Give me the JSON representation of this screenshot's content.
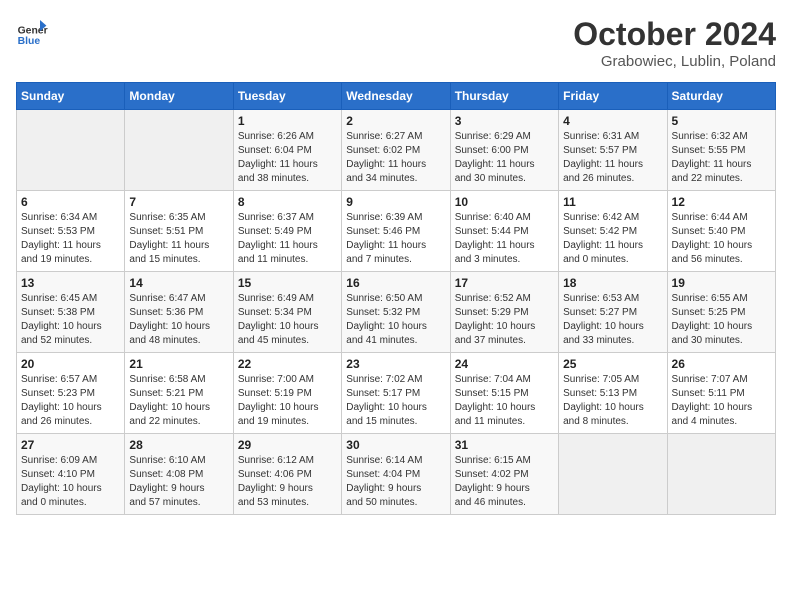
{
  "header": {
    "logo_line1": "General",
    "logo_line2": "Blue",
    "title": "October 2024",
    "subtitle": "Grabowiec, Lublin, Poland"
  },
  "weekdays": [
    "Sunday",
    "Monday",
    "Tuesday",
    "Wednesday",
    "Thursday",
    "Friday",
    "Saturday"
  ],
  "weeks": [
    [
      {
        "day": "",
        "info": ""
      },
      {
        "day": "",
        "info": ""
      },
      {
        "day": "1",
        "info": "Sunrise: 6:26 AM\nSunset: 6:04 PM\nDaylight: 11 hours\nand 38 minutes."
      },
      {
        "day": "2",
        "info": "Sunrise: 6:27 AM\nSunset: 6:02 PM\nDaylight: 11 hours\nand 34 minutes."
      },
      {
        "day": "3",
        "info": "Sunrise: 6:29 AM\nSunset: 6:00 PM\nDaylight: 11 hours\nand 30 minutes."
      },
      {
        "day": "4",
        "info": "Sunrise: 6:31 AM\nSunset: 5:57 PM\nDaylight: 11 hours\nand 26 minutes."
      },
      {
        "day": "5",
        "info": "Sunrise: 6:32 AM\nSunset: 5:55 PM\nDaylight: 11 hours\nand 22 minutes."
      }
    ],
    [
      {
        "day": "6",
        "info": "Sunrise: 6:34 AM\nSunset: 5:53 PM\nDaylight: 11 hours\nand 19 minutes."
      },
      {
        "day": "7",
        "info": "Sunrise: 6:35 AM\nSunset: 5:51 PM\nDaylight: 11 hours\nand 15 minutes."
      },
      {
        "day": "8",
        "info": "Sunrise: 6:37 AM\nSunset: 5:49 PM\nDaylight: 11 hours\nand 11 minutes."
      },
      {
        "day": "9",
        "info": "Sunrise: 6:39 AM\nSunset: 5:46 PM\nDaylight: 11 hours\nand 7 minutes."
      },
      {
        "day": "10",
        "info": "Sunrise: 6:40 AM\nSunset: 5:44 PM\nDaylight: 11 hours\nand 3 minutes."
      },
      {
        "day": "11",
        "info": "Sunrise: 6:42 AM\nSunset: 5:42 PM\nDaylight: 11 hours\nand 0 minutes."
      },
      {
        "day": "12",
        "info": "Sunrise: 6:44 AM\nSunset: 5:40 PM\nDaylight: 10 hours\nand 56 minutes."
      }
    ],
    [
      {
        "day": "13",
        "info": "Sunrise: 6:45 AM\nSunset: 5:38 PM\nDaylight: 10 hours\nand 52 minutes."
      },
      {
        "day": "14",
        "info": "Sunrise: 6:47 AM\nSunset: 5:36 PM\nDaylight: 10 hours\nand 48 minutes."
      },
      {
        "day": "15",
        "info": "Sunrise: 6:49 AM\nSunset: 5:34 PM\nDaylight: 10 hours\nand 45 minutes."
      },
      {
        "day": "16",
        "info": "Sunrise: 6:50 AM\nSunset: 5:32 PM\nDaylight: 10 hours\nand 41 minutes."
      },
      {
        "day": "17",
        "info": "Sunrise: 6:52 AM\nSunset: 5:29 PM\nDaylight: 10 hours\nand 37 minutes."
      },
      {
        "day": "18",
        "info": "Sunrise: 6:53 AM\nSunset: 5:27 PM\nDaylight: 10 hours\nand 33 minutes."
      },
      {
        "day": "19",
        "info": "Sunrise: 6:55 AM\nSunset: 5:25 PM\nDaylight: 10 hours\nand 30 minutes."
      }
    ],
    [
      {
        "day": "20",
        "info": "Sunrise: 6:57 AM\nSunset: 5:23 PM\nDaylight: 10 hours\nand 26 minutes."
      },
      {
        "day": "21",
        "info": "Sunrise: 6:58 AM\nSunset: 5:21 PM\nDaylight: 10 hours\nand 22 minutes."
      },
      {
        "day": "22",
        "info": "Sunrise: 7:00 AM\nSunset: 5:19 PM\nDaylight: 10 hours\nand 19 minutes."
      },
      {
        "day": "23",
        "info": "Sunrise: 7:02 AM\nSunset: 5:17 PM\nDaylight: 10 hours\nand 15 minutes."
      },
      {
        "day": "24",
        "info": "Sunrise: 7:04 AM\nSunset: 5:15 PM\nDaylight: 10 hours\nand 11 minutes."
      },
      {
        "day": "25",
        "info": "Sunrise: 7:05 AM\nSunset: 5:13 PM\nDaylight: 10 hours\nand 8 minutes."
      },
      {
        "day": "26",
        "info": "Sunrise: 7:07 AM\nSunset: 5:11 PM\nDaylight: 10 hours\nand 4 minutes."
      }
    ],
    [
      {
        "day": "27",
        "info": "Sunrise: 6:09 AM\nSunset: 4:10 PM\nDaylight: 10 hours\nand 0 minutes."
      },
      {
        "day": "28",
        "info": "Sunrise: 6:10 AM\nSunset: 4:08 PM\nDaylight: 9 hours\nand 57 minutes."
      },
      {
        "day": "29",
        "info": "Sunrise: 6:12 AM\nSunset: 4:06 PM\nDaylight: 9 hours\nand 53 minutes."
      },
      {
        "day": "30",
        "info": "Sunrise: 6:14 AM\nSunset: 4:04 PM\nDaylight: 9 hours\nand 50 minutes."
      },
      {
        "day": "31",
        "info": "Sunrise: 6:15 AM\nSunset: 4:02 PM\nDaylight: 9 hours\nand 46 minutes."
      },
      {
        "day": "",
        "info": ""
      },
      {
        "day": "",
        "info": ""
      }
    ]
  ]
}
